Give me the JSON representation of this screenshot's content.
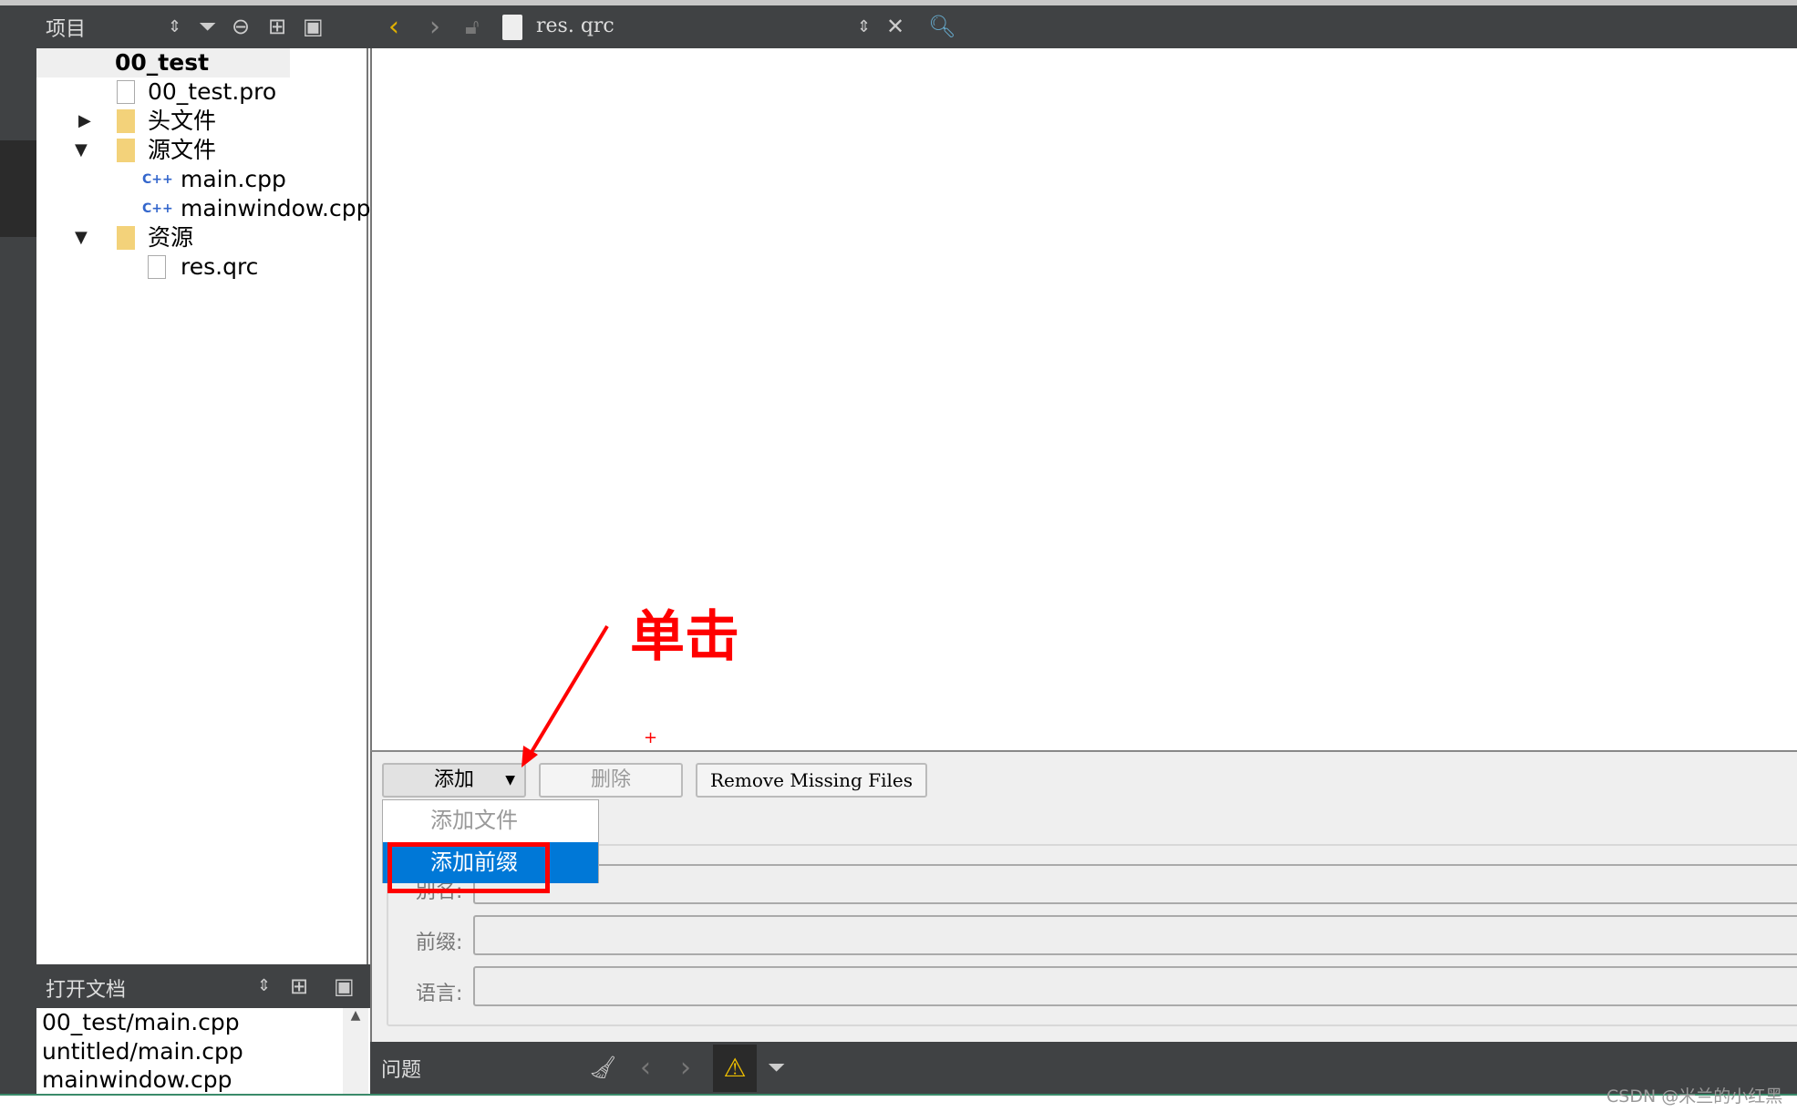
{
  "project_panel": {
    "title": "项目",
    "icons": [
      "sort-updown-icon",
      "filter-icon",
      "link-icon",
      "split-icon",
      "close-panel-icon"
    ]
  },
  "tree": [
    {
      "label": "00_test",
      "icon": "qt-project-folder-icon",
      "expanded": true,
      "bold": true
    },
    {
      "label": "00_test.pro",
      "icon": "qt-pro-file-icon"
    },
    {
      "label": "头文件",
      "icon": "header-folder-icon",
      "expanded": false
    },
    {
      "label": "源文件",
      "icon": "source-folder-icon",
      "expanded": true
    },
    {
      "label": "main.cpp",
      "icon": "cpp-file-icon"
    },
    {
      "label": "mainwindow.cpp",
      "icon": "cpp-file-icon"
    },
    {
      "label": "资源",
      "icon": "resource-folder-icon",
      "expanded": true
    },
    {
      "label": "res.qrc",
      "icon": "qrc-file-icon"
    }
  ],
  "editor_toolbar": {
    "file": "res. qrc"
  },
  "resource_editor": {
    "add_label": "添加",
    "remove_label": "删除",
    "remove_missing_label": "Remove Missing Files",
    "menu": [
      "添加文件",
      "添加前缀"
    ],
    "alias_label": "别名:",
    "prefix_label": "前缀:",
    "language_label": "语言:"
  },
  "annotation": {
    "text": "单击",
    "color": "#ff0000"
  },
  "open_docs": {
    "title": "打开文档",
    "items": [
      "00_test/main.cpp",
      "untitled/main.cpp",
      "mainwindow.cpp"
    ]
  },
  "problems": {
    "title": "问题"
  },
  "watermark": "CSDN @米兰的小红黑",
  "colors": {
    "dark": "#404244",
    "highlight": "#0078d7",
    "accent": "#f0c000"
  }
}
